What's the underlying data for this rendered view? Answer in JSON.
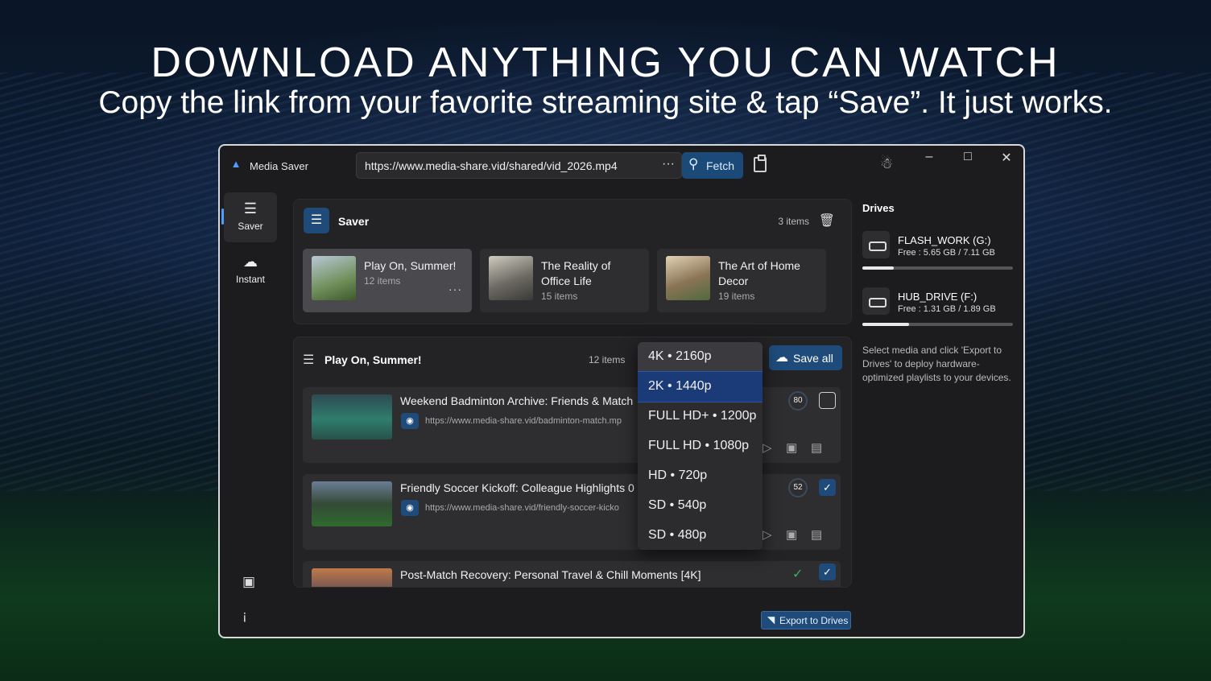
{
  "hero": {
    "title": "DOWNLOAD ANYTHING YOU CAN WATCH",
    "subtitle": "Copy the link from your favorite streaming site & tap “Save”. It just works."
  },
  "app": {
    "title": "Media Saver",
    "url_value": "https://www.media-share.vid/shared/vid_2026.mp4",
    "more_glyph": "···",
    "fetch_label": "Fetch"
  },
  "rail": {
    "items": [
      {
        "label": "Saver",
        "icon": "layers-icon"
      },
      {
        "label": "Instant",
        "icon": "cloud-icon"
      }
    ]
  },
  "saver": {
    "title": "Saver",
    "count": "3 items",
    "playlists": [
      {
        "name": "Play On, Summer!",
        "count": "12 items",
        "thumb_color": "#6f8f5a"
      },
      {
        "name": "The Reality of Office Life",
        "count": "15 items",
        "thumb_color": "#6c6a62"
      },
      {
        "name": "The Art of Home Decor",
        "count": "19 items",
        "thumb_color": "#8a7456"
      }
    ]
  },
  "list": {
    "title": "Play On, Summer!",
    "count": "12 items",
    "save_all_label": "Save all",
    "rows": [
      {
        "title": "Weekend Badminton Archive: Friends & Match",
        "url": "https://www.media-share.vid/badminton-match.mp",
        "quality": "80",
        "checked": false
      },
      {
        "title": "Friendly Soccer Kickoff: Colleague Highlights 0",
        "url": "https://www.media-share.vid/friendly-soccer-kicko",
        "quality": "52",
        "checked": true
      },
      {
        "title": "Post-Match Recovery: Personal Travel & Chill Moments [4K]",
        "url": "",
        "quality": "",
        "checked": true
      }
    ]
  },
  "resolution_menu": {
    "options": [
      "4K • 2160p",
      "2K • 1440p",
      "FULL HD+ • 1200p",
      "FULL HD • 1080p",
      "HD • 720p",
      "SD • 540p",
      "SD • 480p"
    ],
    "selected": "2K • 1440p"
  },
  "export": {
    "label": "Export to Drives"
  },
  "drives": {
    "title": "Drives",
    "items": [
      {
        "name": "FLASH_WORK (G:)",
        "free": "Free :  5.65 GB / 7.11 GB",
        "used_fraction": 0.21
      },
      {
        "name": "HUB_DRIVE (F:)",
        "free": "Free :  1.31 GB / 1.89 GB",
        "used_fraction": 0.31
      }
    ],
    "hint": "Select media and click 'Export to Drives' to deploy hardware-optimized playlists to your devices."
  },
  "colors": {
    "accent": "#1f4b7a",
    "selected_option": "#1a3a78",
    "done_check": "#3fae5a"
  }
}
